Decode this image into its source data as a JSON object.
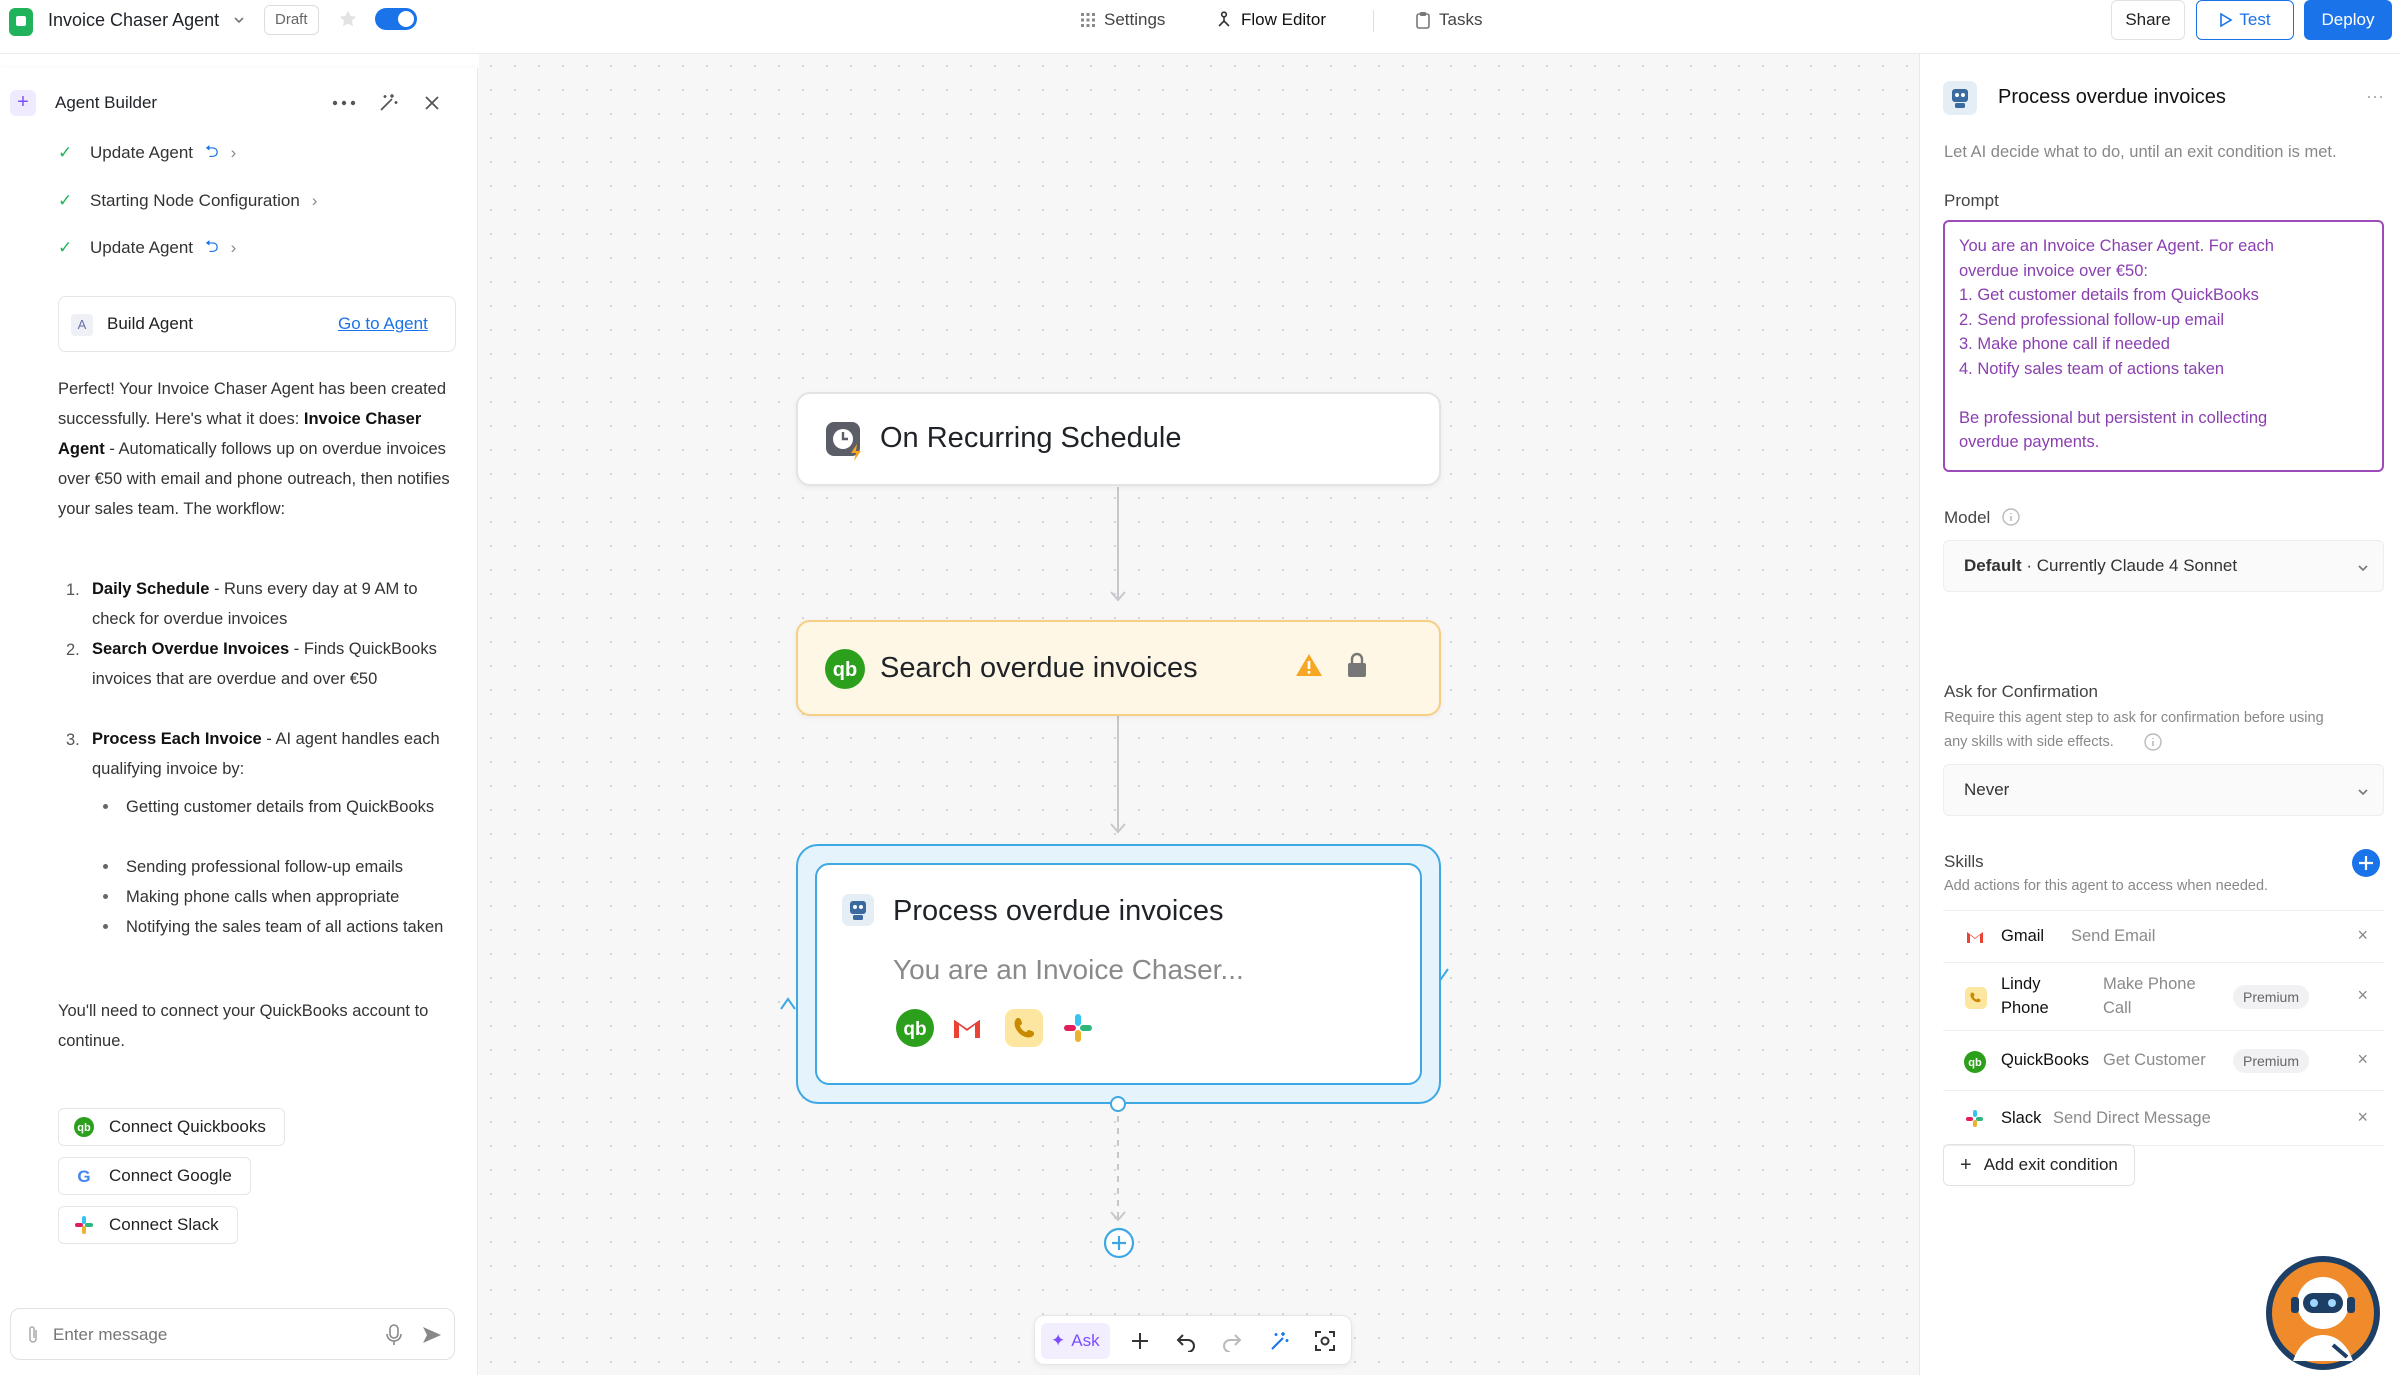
{
  "topbar": {
    "app_title": "Invoice Chaser Agent",
    "draft_label": "Draft",
    "nav_settings": "Settings",
    "nav_flow_editor": "Flow Editor",
    "nav_tasks": "Tasks",
    "share_label": "Share",
    "test_label": "Test",
    "deploy_label": "Deploy"
  },
  "left_panel": {
    "title": "Agent Builder",
    "steps": [
      "Update Agent",
      "Starting Node Configuration",
      "Update Agent"
    ],
    "build_card": {
      "label": "Build Agent",
      "link": "Go to Agent"
    },
    "message": {
      "intro": "Perfect! Your Invoice Chaser Agent has been created successfully. Here's what it does:",
      "agent_name": "Invoice Chaser Agent",
      "agent_desc": " - Automatically follows up on overdue invoices over €50 with email and phone outreach, then notifies your sales team.",
      "workflow_label": "The workflow:",
      "items": [
        {
          "num": "1.",
          "title": "Daily Schedule",
          "desc": " - Runs every day at 9 AM to check for overdue invoices"
        },
        {
          "num": "2.",
          "title": "Search Overdue Invoices",
          "desc": " - Finds QuickBooks invoices that are overdue and over €50"
        },
        {
          "num": "3.",
          "title": "Process Each Invoice",
          "desc": " - AI agent handles each qualifying invoice by:"
        }
      ],
      "bullets": [
        "Getting customer details from QuickBooks",
        "Sending professional follow-up emails",
        "Making phone calls when appropriate",
        "Notifying the sales team of all actions taken"
      ],
      "outro": "You'll need to connect your QuickBooks account to continue."
    },
    "connect_buttons": [
      "Connect Quickbooks",
      "Connect Google",
      "Connect Slack"
    ],
    "input_placeholder": "Enter message"
  },
  "canvas": {
    "trigger_node": "On Recurring Schedule",
    "search_node": "Search overdue invoices",
    "agent_node": {
      "title": "Process overdue invoices",
      "preview": "You are an Invoice Chaser..."
    },
    "toolbar": {
      "ask_label": "Ask"
    }
  },
  "right_panel": {
    "title": "Process overdue invoices",
    "subtitle": "Let AI decide what to do, until an exit condition is met.",
    "prompt_label": "Prompt",
    "prompt_lines": [
      "You are an Invoice Chaser Agent. For each",
      "overdue invoice over €50:",
      "1. Get customer details from QuickBooks",
      "2. Send professional follow-up email",
      "3. Make phone call if needed",
      "4. Notify sales team of actions taken",
      "",
      "Be professional but persistent in collecting",
      "overdue payments."
    ],
    "model_label": "Model",
    "model_value_strong": "Default",
    "model_value_rest": " · Currently Claude 4 Sonnet",
    "confirm_label": "Ask for Confirmation",
    "confirm_desc_1": "Require this agent step to ask for confirmation before using",
    "confirm_desc_2": "any skills with side effects.",
    "confirm_value": "Never",
    "skills_label": "Skills",
    "skills_desc": "Add actions for this agent to access when needed.",
    "skills": [
      {
        "name": "Gmail",
        "action": "Send Email",
        "badge": ""
      },
      {
        "name_1": "Lindy",
        "name_2": "Phone",
        "action_1": "Make Phone",
        "action_2": "Call",
        "badge": "Premium"
      },
      {
        "name": "QuickBooks",
        "action": "Get Customer",
        "badge": "Premium"
      },
      {
        "name": "Slack",
        "action": "Send Direct Message",
        "badge": ""
      }
    ],
    "add_exit_label": "Add exit condition"
  },
  "colors": {
    "accent": "#1a73e8",
    "quickbooks": "#2ca01c",
    "warning": "#f5a623",
    "prompt_text": "#8a3fb0",
    "search_node_bg": "#fff7e6",
    "agent_node_border": "#3ea8e5"
  }
}
